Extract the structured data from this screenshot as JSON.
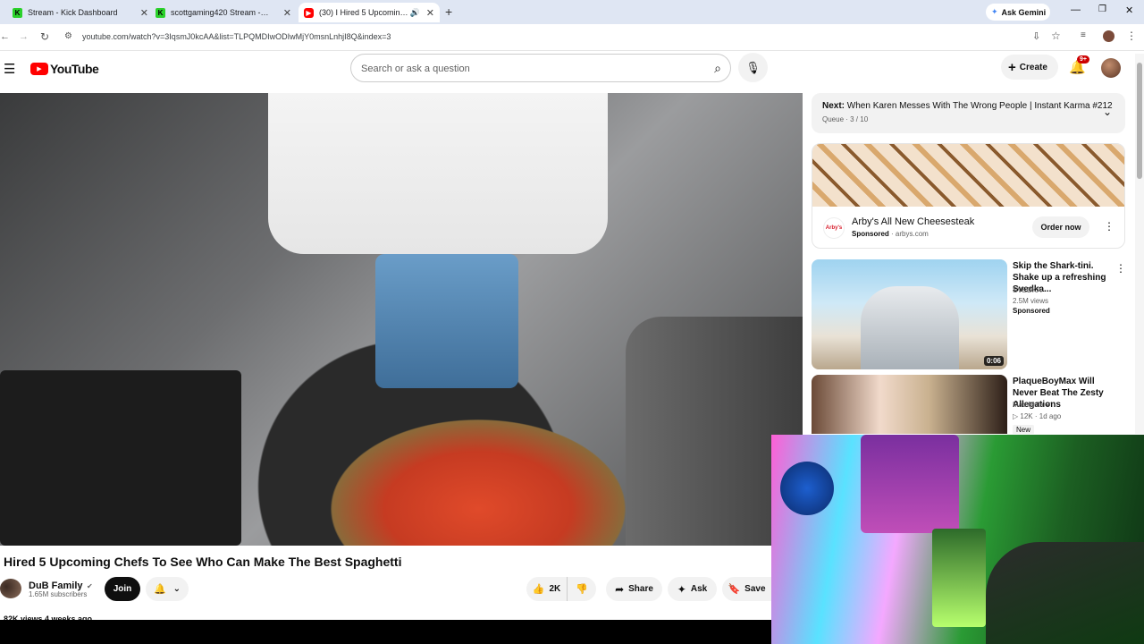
{
  "tabs": [
    {
      "title": "Stream - Kick Dashboard",
      "favicon": "kick-icon",
      "active": false
    },
    {
      "title": "scottgaming420 Stream - Watc",
      "favicon": "kick-icon",
      "active": false
    },
    {
      "title": "(30) I Hired 5 Upcoming Ch",
      "favicon": "youtube-icon",
      "active": true
    }
  ],
  "browser": {
    "ask_gemini": "Ask Gemini",
    "url": "youtube.com/watch?v=3IqsmJ0kcAA&list=TLPQMDIwODIwMjY0msnLnhjI8Q&index=3"
  },
  "youtube": {
    "logo_text": "YouTube",
    "search_placeholder": "Search or ask a question",
    "create_label": "Create",
    "notif_badge": "9+"
  },
  "queue": {
    "next_label": "Next:",
    "next_title": "When Karen Messes With The Wrong People | Instant Karma #212",
    "position": "Queue · 3 / 10"
  },
  "ad": {
    "title": "Arby's All New Cheesesteak",
    "sponsored": "Sponsored",
    "domain": "arbys.com",
    "cta": "Order now",
    "logo_text": "Arby's"
  },
  "recs": [
    {
      "title": "Skip the Shark-tini. Shake up a refreshing Svedka...",
      "channel": "SVEDKA",
      "views": "2.5M views",
      "meta": "Sponsored",
      "duration": "0:06"
    },
    {
      "title": "PlaqueBoyMax Will Never Beat The Zesty Allegations",
      "channel": "Mac Mula",
      "views": "12K",
      "meta": "1d ago",
      "badge": "New"
    }
  ],
  "video": {
    "title": "Hired 5 Upcoming Chefs To See Who Can Make The Best Spaghetti",
    "channel": "DuB Family",
    "subscribers": "1.65M subscribers",
    "join": "Join",
    "likes": "2K",
    "share": "Share",
    "ask": "Ask",
    "save": "Save",
    "views_partial": "82K views  4 weeks ago"
  },
  "colors": {
    "brand_red": "#ff0000",
    "tabstrip": "#dfe6f3",
    "pill_bg": "#f2f2f2",
    "join_bg": "#0f0f0f"
  }
}
